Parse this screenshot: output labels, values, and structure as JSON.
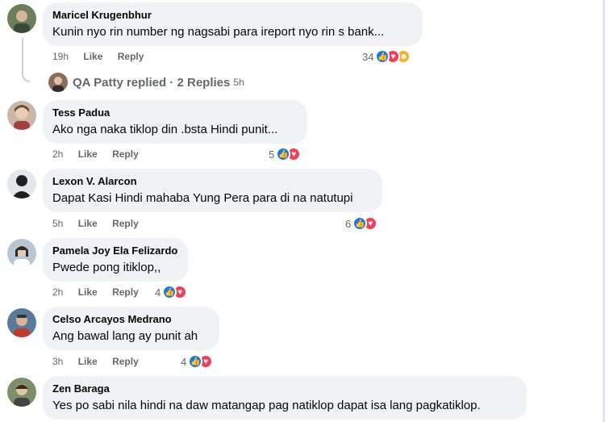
{
  "comments": [
    {
      "author": "Maricel Krugenbhur",
      "text": "Kunin nyo rin number ng nagsabi para ireport nyo rin s bank...",
      "time": "19h",
      "like": "Like",
      "reply": "Reply",
      "reactions": "34",
      "reaction_icons": [
        "like-icon",
        "love-icon",
        "care-icon"
      ]
    },
    {
      "author": "Tess Padua",
      "text": "Ako nga naka tiklop din .bsta Hindi punit...",
      "time": "2h",
      "like": "Like",
      "reply": "Reply",
      "reactions": "5",
      "reaction_icons": [
        "like-icon",
        "love-icon"
      ]
    },
    {
      "author": "Lexon V. Alarcon",
      "text": "Dapat Kasi Hindi mahaba Yung Pera para di na natutupi",
      "time": "5h",
      "like": "Like",
      "reply": "Reply",
      "reactions": "6",
      "reaction_icons": [
        "like-icon",
        "love-icon"
      ]
    },
    {
      "author": "Pamela Joy Ela Felizardo",
      "text": "Pwede pong itiklop,,",
      "time": "2h",
      "like": "Like",
      "reply": "Reply",
      "reactions": "4",
      "reaction_icons": [
        "like-icon",
        "love-icon"
      ]
    },
    {
      "author": "Celso Arcayos Medrano",
      "text": "Ang bawal lang ay punit ah",
      "time": "3h",
      "like": "Like",
      "reply": "Reply",
      "reactions": "4",
      "reaction_icons": [
        "like-icon",
        "love-icon"
      ]
    },
    {
      "author": "Zen Baraga",
      "text": "Yes po sabi nila hindi na daw matangap pag natiklop dapat isa lang pagkatiklop."
    }
  ],
  "replies_link": {
    "text": "QA Patty replied · 2 Replies",
    "time": "5h"
  },
  "colors": {
    "like": "#1877f2",
    "love": "#f33e58",
    "care": "#f7b125",
    "bubble": "#f0f2f5",
    "muted": "#65676b"
  }
}
